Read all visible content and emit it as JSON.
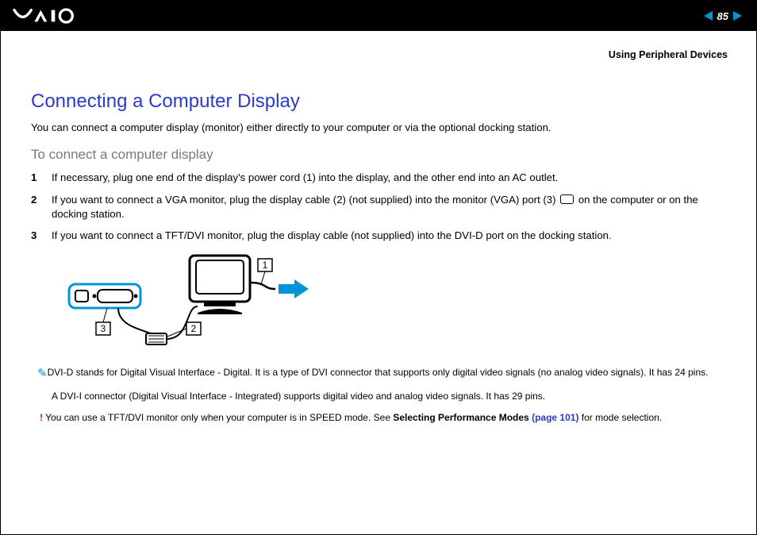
{
  "header": {
    "page_number": "85",
    "section_label": "Using Peripheral Devices"
  },
  "title": "Connecting a Computer Display",
  "intro": "You can connect a computer display (monitor) either directly to your computer or via the optional docking station.",
  "subhead": "To connect a computer display",
  "steps": [
    {
      "n": "1",
      "text": "If necessary, plug one end of the display's power cord (1) into the display, and the other end into an AC outlet."
    },
    {
      "n": "2",
      "pretext": "If you want to connect a VGA monitor, plug the display cable (2) (not supplied) into the monitor (VGA) port (3) ",
      "posttext": " on the computer or on the docking station."
    },
    {
      "n": "3",
      "text": "If you want to connect a TFT/DVI monitor, plug the display cable (not supplied) into the DVI-D port on the docking station."
    }
  ],
  "diagram_labels": {
    "l1": "1",
    "l2": "2",
    "l3": "3"
  },
  "notes": {
    "dvi_d": "DVI-D stands for Digital Visual Interface - Digital. It is a type of DVI connector that supports only digital video signals (no analog video signals). It has 24 pins.",
    "dvi_i": "A DVI-I connector (Digital Visual Interface - Integrated) supports digital video and analog video signals. It has 29 pins.",
    "warn_pre": "You can use a TFT/DVI monitor only when your computer is in SPEED mode. See ",
    "warn_bold": "Selecting Performance Modes ",
    "warn_link": "(page 101)",
    "warn_post": " for mode selection."
  }
}
